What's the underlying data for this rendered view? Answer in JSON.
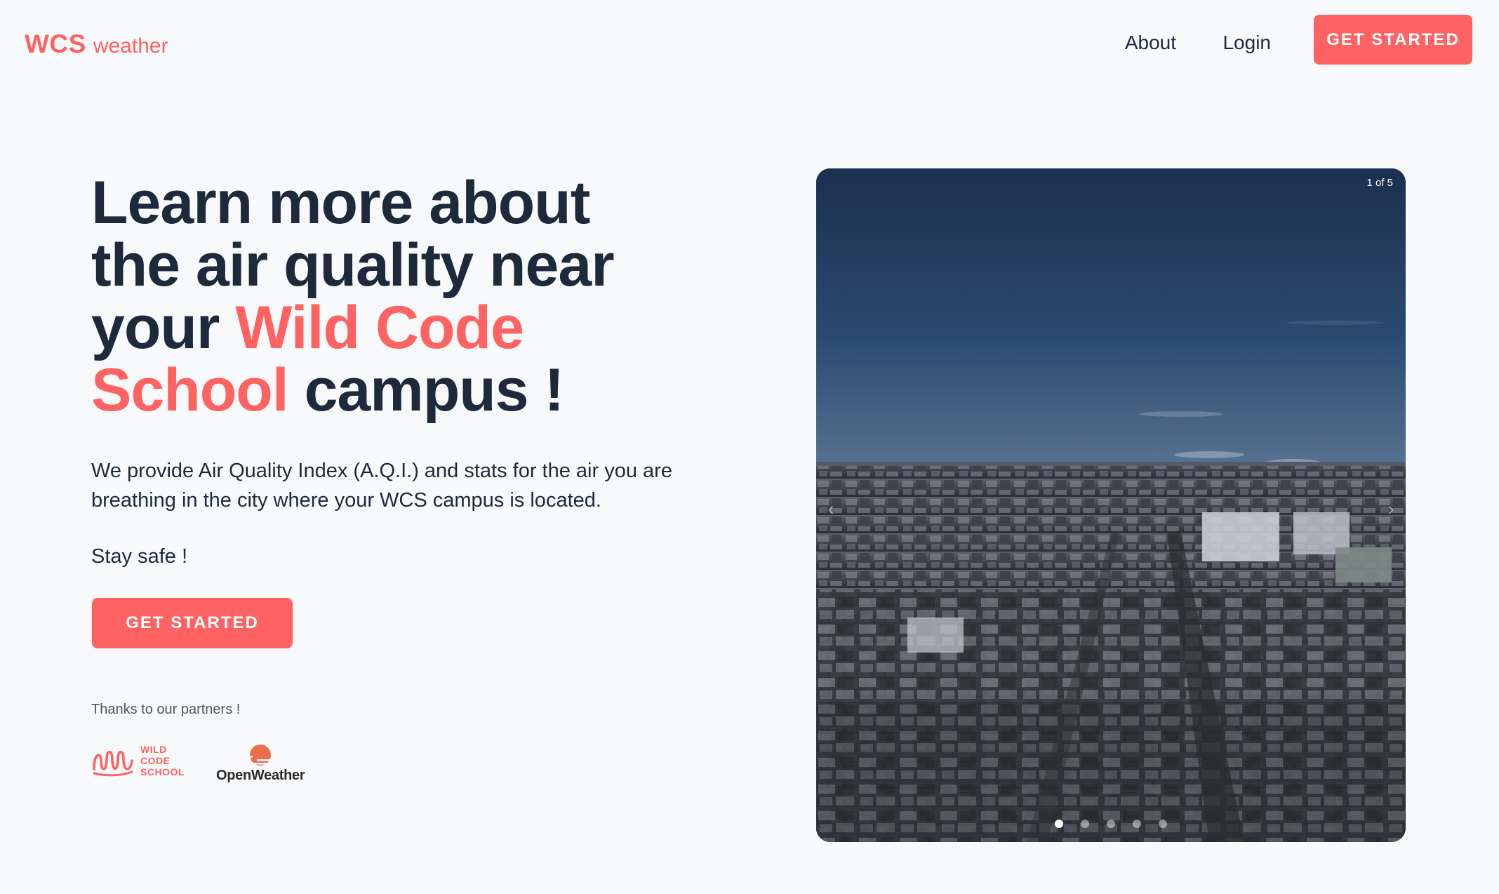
{
  "header": {
    "logo_brand": "WCS",
    "logo_sub": "weather",
    "nav_about": "About",
    "nav_login": "Login",
    "cta_label": "GET STARTED"
  },
  "hero": {
    "title_part1": "Learn more about the air quality near your ",
    "title_accent": "Wild Code School",
    "title_part2": " campus !",
    "description": "We provide Air Quality Index (A.Q.I.) and stats for the air you are breathing in the city where your WCS campus is located.",
    "stay_safe": "Stay safe !",
    "cta_label": "GET STARTED"
  },
  "partners": {
    "label": "Thanks to our partners !",
    "wcs_line1": "WILD",
    "wcs_line2": "CODE",
    "wcs_line3": "SCHOOL",
    "openweather": "OpenWeather"
  },
  "carousel": {
    "counter": "1 of 5",
    "prev_icon": "chevron-left-icon",
    "next_icon": "chevron-right-icon",
    "slide_count": 5,
    "active_index": 0
  },
  "colors": {
    "accent": "#fe6262",
    "text": "#1e2a3b",
    "background": "#f8f9fb"
  }
}
